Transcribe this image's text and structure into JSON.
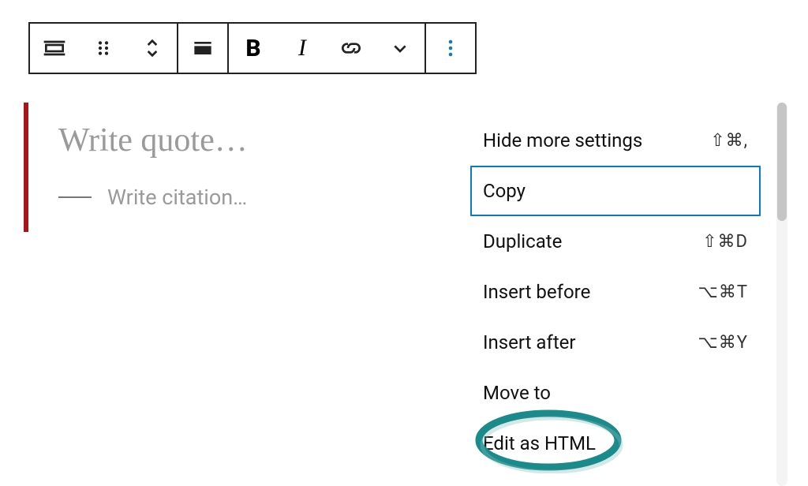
{
  "toolbar": {
    "bold": "B",
    "italic": "I"
  },
  "quote": {
    "placeholder": "Write quote…",
    "citation_placeholder": "Write citation…"
  },
  "menu": {
    "items": [
      {
        "label": "Hide more settings",
        "shortcut": "⇧⌘,"
      },
      {
        "label": "Copy",
        "shortcut": "",
        "highlighted": true
      },
      {
        "label": "Duplicate",
        "shortcut": "⇧⌘D"
      },
      {
        "label": "Insert before",
        "shortcut": "⌥⌘T"
      },
      {
        "label": "Insert after",
        "shortcut": "⌥⌘Y"
      },
      {
        "label": "Move to",
        "shortcut": ""
      },
      {
        "label": "Edit as HTML",
        "shortcut": ""
      }
    ]
  },
  "colors": {
    "quote_border": "#a9161a",
    "menu_highlight": "#0a7bbf",
    "annotation": "#1a8a8a"
  }
}
